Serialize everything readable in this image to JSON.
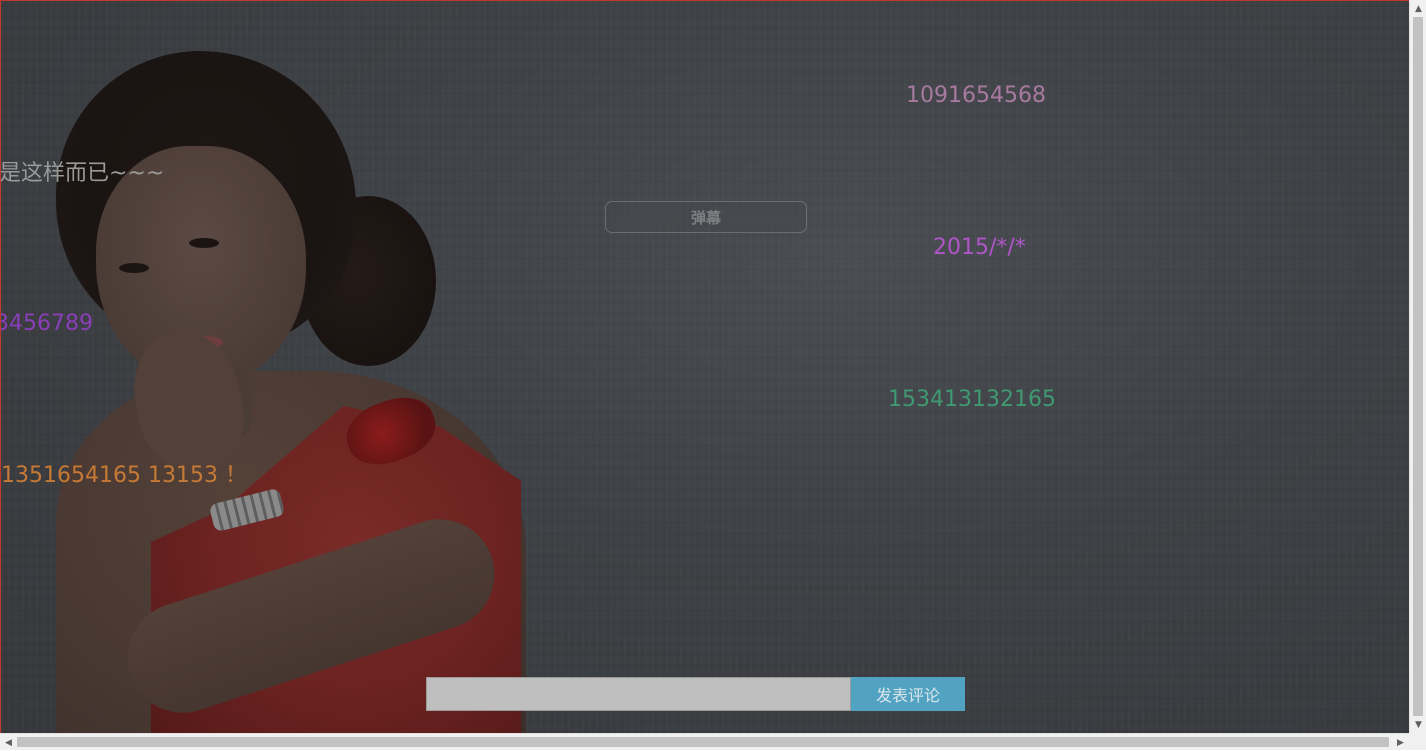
{
  "danmaku": [
    {
      "text": "1091654568",
      "color": "#a87aa0"
    },
    {
      "text": "是这样而已~~~",
      "color": "#9a9a9a"
    },
    {
      "text": "2015/*/*",
      "color": "#b055c8"
    },
    {
      "text": "3456789",
      "color": "#8a3fb8"
    },
    {
      "text": "153413132165",
      "color": "#3f9a72"
    },
    {
      "text": "1351654165 13153 ！",
      "color": "#c67a35"
    }
  ],
  "toggle_button": {
    "label": "弹幕"
  },
  "comment": {
    "input_value": "",
    "submit_label": "发表评论",
    "submit_color": "#52a3c2"
  },
  "scrollbars": {
    "up_arrow_icon": "▲",
    "down_arrow_icon": "▼",
    "left_arrow_icon": "◀",
    "right_arrow_icon": "▶"
  }
}
